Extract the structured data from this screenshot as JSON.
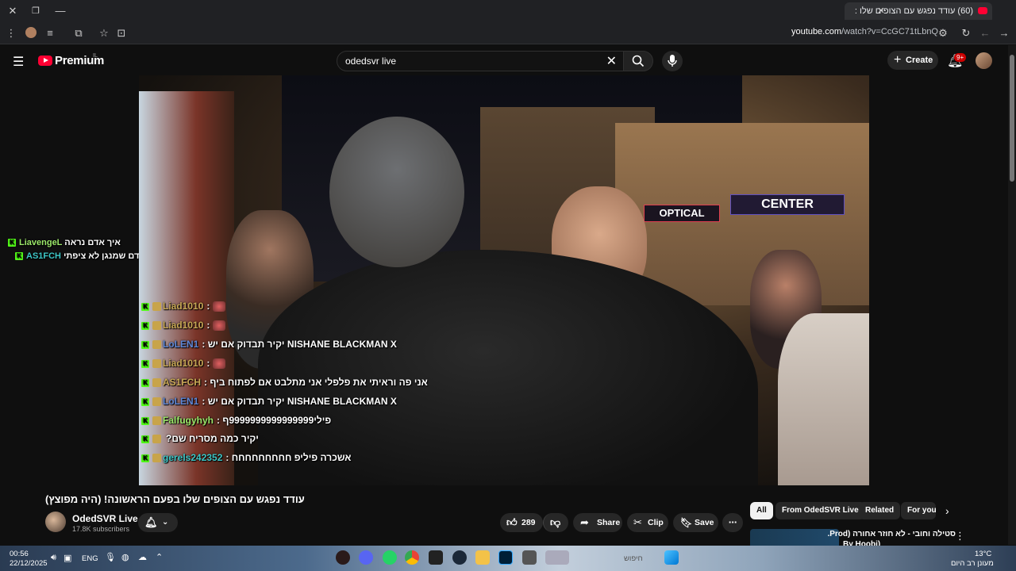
{
  "browser": {
    "tab_title": "(60) עודד נפגש עם הצופים שלו :",
    "url_domain": "youtube.com",
    "url_path": "/watch?v=CcGC71tLbnQ"
  },
  "header": {
    "logo_text": "Premium",
    "region": "IL",
    "search_value": "odedsvr live",
    "create_label": "Create",
    "notif_count": "9+"
  },
  "video": {
    "sign_optical": "OPTICAL",
    "sign_center": "CENTER",
    "chat_top": [
      {
        "name": "LiavengeL",
        "msg": "איך אדם נראה"
      },
      {
        "name": "AS1FCH",
        "msg": "אדם שמנגן לא ציפתי"
      }
    ],
    "chat": [
      {
        "name": "Liad1010",
        "msg": ":",
        "color": "gold",
        "emote": true
      },
      {
        "name": "Liad1010",
        "msg": ":",
        "color": "gold",
        "emote": true
      },
      {
        "name": "LoLEN1",
        "msg": ": יקיר תבדוק אם יש NISHANE BLACKMAN X",
        "color": "blue"
      },
      {
        "name": "Liad1010",
        "msg": ":",
        "color": "gold",
        "emote": true
      },
      {
        "name": "AS1FCH",
        "msg": ": אני פה וראיתי את פלפלי אני מתלבט אם לפתוח ביף",
        "color": "gold"
      },
      {
        "name": "LoLEN1",
        "msg": ": יקיר תבדוק אם יש NISHANE BLACKMAN X",
        "color": "blue"
      },
      {
        "name": "Falfugyhyh",
        "msg": ": פילי9999999999999999ף",
        "color": "green"
      },
      {
        "name": "",
        "msg": "?יקיר כמה מסריח שם",
        "color": "blue"
      },
      {
        "name": "gerels242352",
        "msg": ": אשכרה פיליפ חחחחחחחחח",
        "color": "teal"
      }
    ]
  },
  "info": {
    "title": "עודד נפגש עם הצופים שלו בפעם הראשונה! (היה מפוצץ)",
    "channel_name": "OdedSVR Live",
    "subscribers": "17.8K subscribers",
    "likes": "289",
    "share_label": "Share",
    "clip_label": "Clip",
    "save_label": "Save"
  },
  "chips": [
    "All",
    "From OdedSVR Live",
    "Related",
    "For you"
  ],
  "recommendation": {
    "title": "סטילה וחובי - לא חוזר אחורה (Prod.",
    "subtitle": "By Hoobi)"
  },
  "taskbar": {
    "time": "00:56",
    "date": "22/12/2025",
    "lang": "ENG",
    "weather_temp": "13°C",
    "weather_text": "מעונן רב היום",
    "search_text": "חיפוש"
  }
}
